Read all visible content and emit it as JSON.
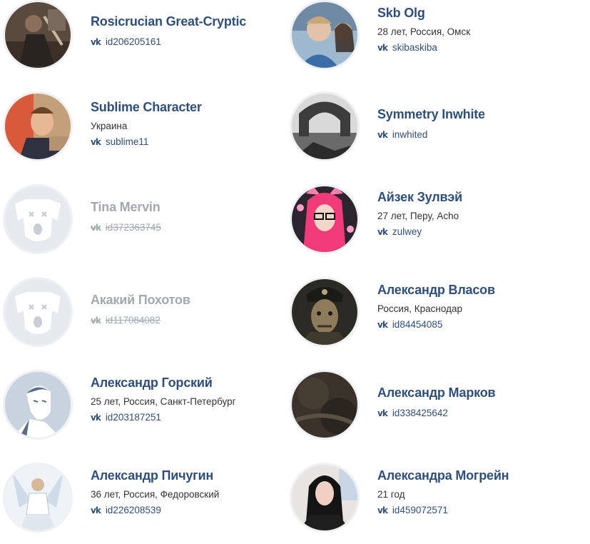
{
  "people": [
    {
      "name": "Rosicrucian Great-Cryptic",
      "meta": "",
      "link": "id206205161",
      "deleted": false,
      "avatar": "dark-warrior-photo"
    },
    {
      "name": "Skb Olg",
      "meta": "28 лет, Россия, Омск",
      "link": "skibaskiba",
      "deleted": false,
      "avatar": "couple-photo"
    },
    {
      "name": "Sublime Character",
      "meta": "Украина",
      "link": "sublime11",
      "deleted": false,
      "avatar": "man-on-couch-photo"
    },
    {
      "name": "Symmetry Inwhite",
      "meta": "",
      "link": "inwhited",
      "deleted": false,
      "avatar": "ruins-arch-photo"
    },
    {
      "name": "Tina Mervin",
      "meta": "",
      "link": "id372363745",
      "deleted": true,
      "avatar": "deleted-dog-icon"
    },
    {
      "name": "Айзек Зулвэй",
      "meta": "27 лет, Перу, Acho",
      "link": "zulwey",
      "deleted": false,
      "avatar": "pink-hair-girl-photo"
    },
    {
      "name": "Акакий Похотов",
      "meta": "",
      "link": "id117084082",
      "deleted": true,
      "avatar": "deleted-dog-icon"
    },
    {
      "name": "Александр Власов",
      "meta": "Россия, Краснодар",
      "link": "id84454085",
      "deleted": false,
      "avatar": "soldier-portrait-photo"
    },
    {
      "name": "Александр Горский",
      "meta": "25 лет, Россия, Санкт-Петербург",
      "link": "id203187251",
      "deleted": false,
      "avatar": "default-man-silhouette"
    },
    {
      "name": "Александр Марков",
      "meta": "",
      "link": "id338425642",
      "deleted": false,
      "avatar": "dark-texture-photo"
    },
    {
      "name": "Александр Пичугин",
      "meta": "36 лет, Россия, Федоровский",
      "link": "id226208539",
      "deleted": false,
      "avatar": "angel-figure-photo"
    },
    {
      "name": "Александра Могрейн",
      "meta": "21 год",
      "link": "id459072571",
      "deleted": false,
      "avatar": "dark-hair-woman-photo"
    }
  ],
  "colors": {
    "link": "#2f4f7b",
    "deleted": "#a3a8b0",
    "avatar_border": "#eef0f3"
  }
}
